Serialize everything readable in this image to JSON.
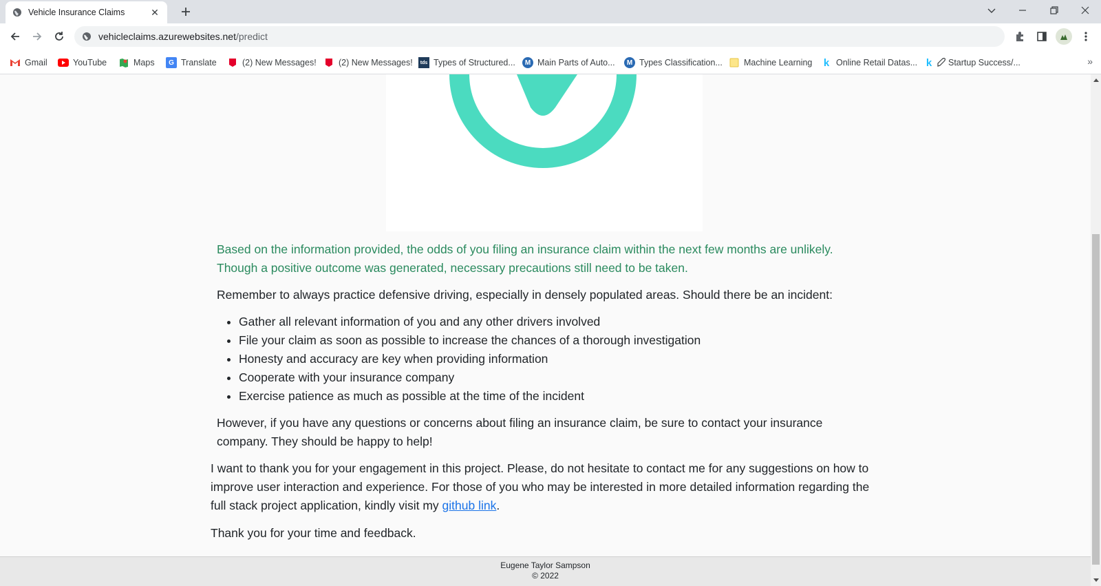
{
  "browser": {
    "tab": {
      "title": "Vehicle Insurance Claims"
    },
    "address": {
      "host": "vehicleclaims.azurewebsites.net",
      "path": "/predict"
    },
    "bookmarks": [
      {
        "label": "Gmail",
        "icon": "gmail-icon"
      },
      {
        "label": "YouTube",
        "icon": "youtube-icon"
      },
      {
        "label": "Maps",
        "icon": "maps-icon"
      },
      {
        "label": "Translate",
        "icon": "translate-icon"
      },
      {
        "label": "(2) New Messages!",
        "icon": "messages-icon"
      },
      {
        "label": "(2) New Messages!",
        "icon": "messages-icon"
      },
      {
        "label": "Types of Structured...",
        "icon": "tds-icon",
        "badge": "tds"
      },
      {
        "label": "Main Parts of Auto...",
        "icon": "medium-icon",
        "badge": "M"
      },
      {
        "label": "Types Classification...",
        "icon": "medium-icon",
        "badge": "M"
      },
      {
        "label": "Machine Learning",
        "icon": "folder-icon"
      },
      {
        "label": "Online Retail Datas...",
        "icon": "kaggle-icon",
        "badge": "k"
      },
      {
        "label": "Startup Success/...",
        "icon": "kaggle-rocket-icon",
        "badge": "k"
      }
    ],
    "overflow_glyph": "»"
  },
  "page": {
    "result_text": "Based on the information provided, the odds of you filing an insurance claim within the next few months are unlikely. Though a positive outcome was generated, necessary precautions still need to be taken.",
    "advice_intro": "Remember to always practice defensive driving, especially in densely populated areas. Should there be an incident:",
    "tips": [
      "Gather all relevant information of you and any other drivers involved",
      "File your claim as soon as possible to increase the chances of a thorough investigation",
      "Honesty and accuracy are key when providing information",
      "Cooperate with your insurance company",
      "Exercise patience as much as possible at the time of the incident"
    ],
    "contact_note": "However, if you have any questions or concerns about filing an insurance claim, be sure to contact your insurance company. They should be happy to help!",
    "thanks_text": "I want to thank you for your engagement in this project. Please, do not hesitate to contact me for any suggestions on how to improve user interaction and experience. For those of you who may be interested in more detailed information regarding the full stack project application, kindly visit my ",
    "github_link": "github link",
    "period": ".",
    "closing": "Thank you for your time and feedback."
  },
  "footer": {
    "author": "Eugene Taylor Sampson",
    "copyright": "© 2022"
  },
  "colors": {
    "accent_green": "#4bdbc0",
    "result_text": "#2a8a5e",
    "link": "#1a73e8"
  }
}
